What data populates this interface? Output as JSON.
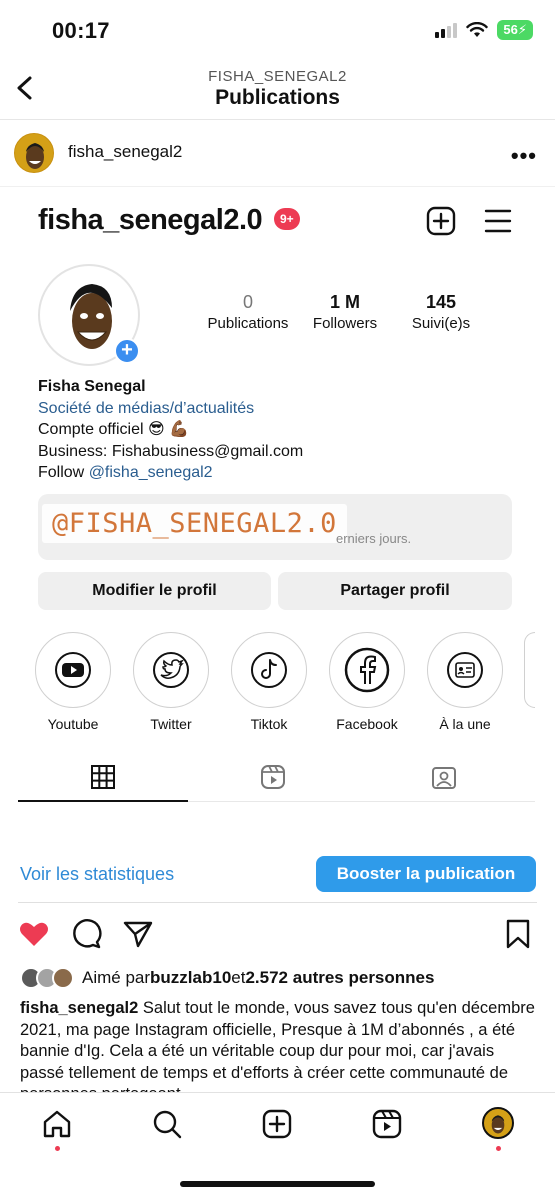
{
  "status_bar": {
    "time": "00:17",
    "battery": "56"
  },
  "nav": {
    "subtitle": "FISHA_SENEGAL2",
    "title": "Publications"
  },
  "post": {
    "username": "fisha_senegal2"
  },
  "embedded_profile": {
    "username": "fisha_senegal2.0",
    "notification_badge": "9+",
    "stats": [
      {
        "value": "0",
        "label": "Publications"
      },
      {
        "value": "1 M",
        "label": "Followers"
      },
      {
        "value": "145",
        "label": "Suivi(e)s"
      }
    ],
    "bio": {
      "name": "Fisha Senegal",
      "category": "Société de médias/d’actualités",
      "line1": "Compte officiel  😎 💪🏾",
      "line2": "Business: Fishabusiness@gmail.com",
      "follow_prefix": "Follow ",
      "follow_handle": "@fisha_senegal2"
    },
    "dashboard_text": "erniers jours.",
    "watermark": "@FISHA_SENEGAL2.0",
    "buttons": {
      "edit": "Modifier le profil",
      "share": "Partager profil"
    },
    "highlights": [
      {
        "label": "Youtube",
        "icon": "youtube-icon"
      },
      {
        "label": "Twitter",
        "icon": "twitter-icon"
      },
      {
        "label": "Tiktok",
        "icon": "tiktok-icon"
      },
      {
        "label": "Facebook",
        "icon": "facebook-icon"
      },
      {
        "label": "À la une",
        "icon": "id-card-icon"
      }
    ]
  },
  "actions": {
    "stats_link": "Voir les statistiques",
    "boost": "Booster la publication"
  },
  "likes": {
    "prefix": "Aimé par ",
    "user": "buzzlab10",
    "middle": " et ",
    "others": "2.572 autres personnes"
  },
  "caption": {
    "username": "fisha_senegal2",
    "text": " Salut tout le monde, vous savez tous qu'en décembre 2021, ma page Instagram officielle, Presque à 1M d’abonnés , a été bannie d'Ig. Cela a été un véritable coup dur pour moi, car j'avais passé tellement de temps et d'efforts à créer cette communauté de personnes partageant"
  },
  "colors": {
    "accent": "#2f9bea",
    "like": "#ed3b53",
    "badge": "#ed3b53"
  }
}
